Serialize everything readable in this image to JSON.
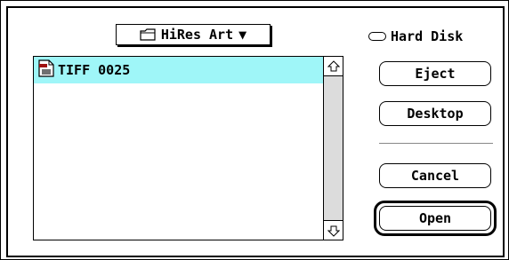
{
  "dialog": {
    "folder_popup": {
      "label": "HiRes Art",
      "icon": "folder-icon",
      "arrow": "▼"
    },
    "volume": {
      "label": "Hard Disk",
      "icon": "hard-disk-icon"
    },
    "files": [
      {
        "name": "TIFF 0025",
        "icon": "tiff-document-icon",
        "selected": true
      }
    ],
    "buttons": {
      "eject": "Eject",
      "desktop": "Desktop",
      "cancel": "Cancel",
      "open": "Open"
    },
    "colors": {
      "selection": "#9ff6f8",
      "scrollbar_track": "#dcdcdc"
    }
  }
}
